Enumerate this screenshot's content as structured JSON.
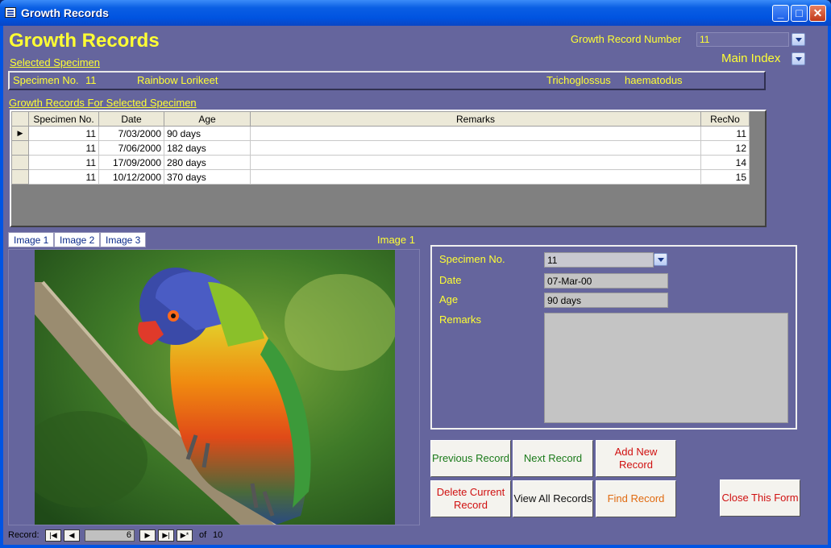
{
  "window": {
    "title": "Growth Records"
  },
  "header": {
    "title": "Growth Records",
    "record_number_label": "Growth Record Number",
    "record_number_value": "11",
    "main_index_label": "Main Index"
  },
  "selected_specimen": {
    "heading": "Selected Specimen",
    "specimen_label": "Specimen No.",
    "specimen_no": "11",
    "common_name": "Rainbow Lorikeet",
    "genus": "Trichoglossus",
    "species": "haematodus"
  },
  "growth_records": {
    "heading": "Growth Records For Selected Specimen",
    "columns": [
      "Specimen No.",
      "Date",
      "Age",
      "Remarks",
      "RecNo"
    ],
    "rows": [
      [
        "11",
        "7/03/2000",
        "90 days",
        "",
        "11"
      ],
      [
        "11",
        "7/06/2000",
        "182 days",
        "",
        "12"
      ],
      [
        "11",
        "17/09/2000",
        "280 days",
        "",
        "14"
      ],
      [
        "11",
        "10/12/2000",
        "370 days",
        "",
        "15"
      ]
    ]
  },
  "image_tabs": [
    "Image 1",
    "Image 2",
    "Image 3"
  ],
  "image_caption": "Image 1",
  "detail": {
    "specimen_label": "Specimen No.",
    "specimen_value": "11",
    "date_label": "Date",
    "date_value": "07-Mar-00",
    "age_label": "Age",
    "age_value": "90 days",
    "remarks_label": "Remarks",
    "remarks_value": ""
  },
  "buttons": {
    "previous": "Previous Record",
    "next": "Next Record",
    "add_new": "Add New Record",
    "delete_current": "Delete Current Record",
    "view_all": "View All Records",
    "find": "Find Record",
    "close": "Close This Form"
  },
  "record_nav": {
    "label": "Record:",
    "current": "6",
    "of_label": "of",
    "total": "10"
  },
  "colors": {
    "background": "#65659d",
    "label_yellow": "#ffff33",
    "green_text": "#1a7a1a",
    "red_text": "#d01010",
    "orange_text": "#e06a10"
  }
}
